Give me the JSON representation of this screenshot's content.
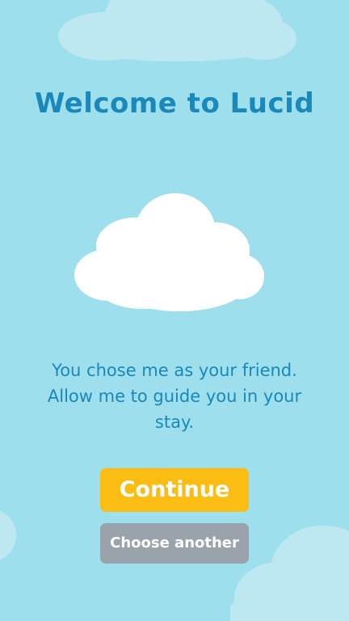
{
  "welcome": {
    "title": "Welcome to Lucid",
    "message_lines": [
      "You chose me as your friend.",
      "Allow me to guide you in your",
      "stay."
    ],
    "continue_label": "Continue",
    "choose_another_label": "Choose another"
  },
  "colors": {
    "background": "#9ddfec",
    "accent_text": "#1a88b9",
    "continue_button": "#fbbd14",
    "choose_another_button": "#9aa3ab",
    "cloud": "#ffffff",
    "background_cloud": "#bde8f2"
  },
  "icons": {
    "hero": "cloud-icon",
    "decoration": "cloud-icon"
  }
}
